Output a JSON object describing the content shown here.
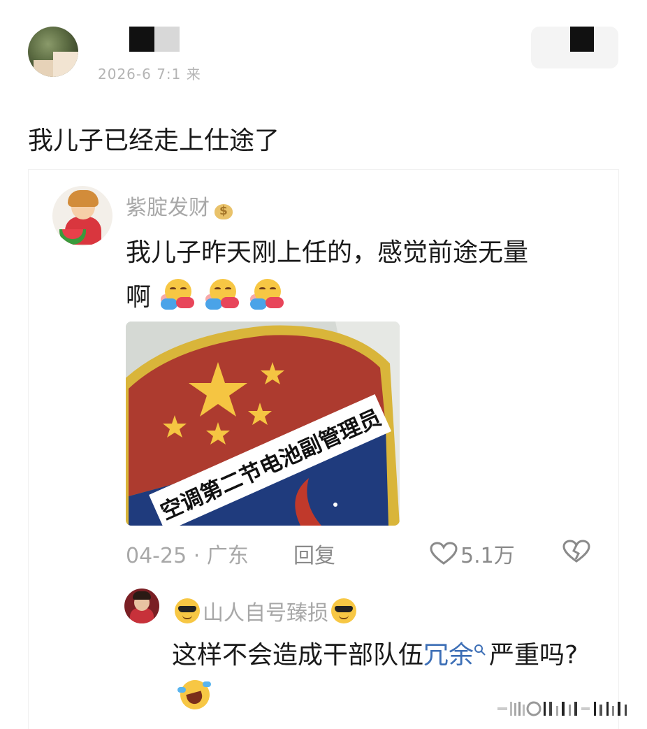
{
  "post": {
    "meta_text": "2026-6  7:1  来",
    "content": "我儿子已经走上仕途了"
  },
  "comment": {
    "author": "紫腚发财",
    "author_badge_icon": "money-bag-icon",
    "text_line1": "我儿子昨天刚上任的，感觉前途无量",
    "text_line2": "啊",
    "emoji_icon": "hugging-face-emoji",
    "emoji_count": 3,
    "image": {
      "label": "空调第二节电池副管理员"
    },
    "date": "04-25",
    "separator": "·",
    "location": "广东",
    "reply_label": "回复",
    "like_count": "5.1万",
    "like_icon": "heart-icon",
    "dislike_icon": "broken-heart-icon"
  },
  "reply": {
    "author": "山人自号臻损",
    "author_emoji_icon": "sunglasses-face-emoji",
    "text_before": "这样不会造成干部队伍",
    "link_text": "冗余",
    "link_icon": "search-icon",
    "text_after": "严重吗?",
    "emoji_icon": "laughing-crying-emoji"
  },
  "colors": {
    "link": "#3d6fb6",
    "meta": "#a8a8a8",
    "badge_red": "#b03a2e",
    "badge_navy": "#1e3a7a",
    "badge_gold": "#d9b53a"
  }
}
